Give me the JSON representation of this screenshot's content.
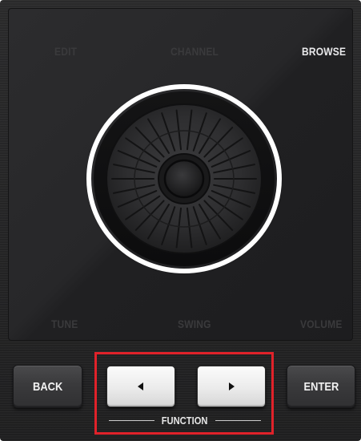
{
  "modes": {
    "top": {
      "edit": "EDIT",
      "channel": "CHANNEL",
      "browse": "BROWSE"
    },
    "bottom": {
      "tune": "TUNE",
      "swing": "SWING",
      "volume": "VOLUME"
    },
    "active": "BROWSE",
    "active_color": "#e8e8ea",
    "inactive_color": "#3a3a3c"
  },
  "encoder": {
    "ring_color": "#ffffff",
    "icon": "control-encoder-knob"
  },
  "buttons": {
    "back_label": "BACK",
    "enter_label": "ENTER",
    "left_icon": "arrow-left-icon",
    "right_icon": "arrow-right-icon"
  },
  "function_group": {
    "label": "FUNCTION",
    "highlight_color": "#e0222a"
  }
}
